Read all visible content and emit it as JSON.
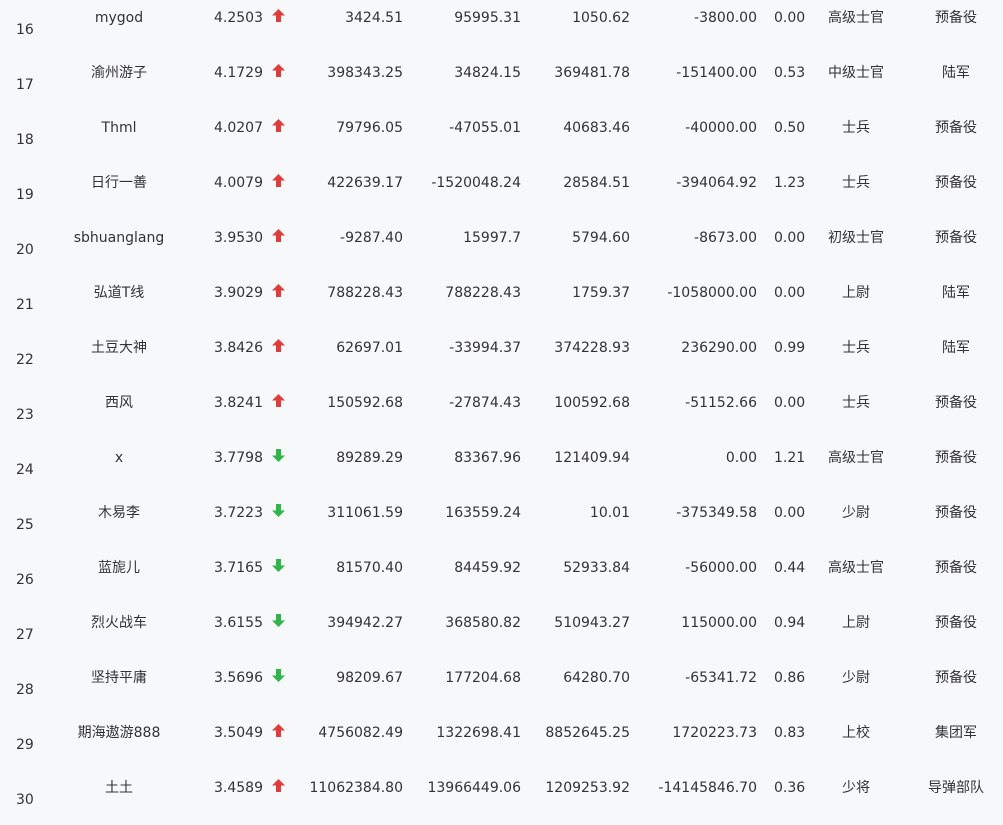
{
  "colors": {
    "up": "#e03c3c",
    "down": "#2fb54a",
    "text": "#333333",
    "background": "#f7f8fa"
  },
  "icons": {
    "up": "arrow-up-icon",
    "down": "arrow-down-icon"
  },
  "rows": [
    {
      "rank": "16",
      "name": "mygod",
      "score": "4.2503",
      "trend": "up",
      "v1": "3424.51",
      "v2": "95995.31",
      "v3": "1050.62",
      "v4": "-3800.00",
      "ratio": "0.00",
      "rank_title": "高级士官",
      "branch": "预备役"
    },
    {
      "rank": "17",
      "name": "渝州游子",
      "score": "4.1729",
      "trend": "up",
      "v1": "398343.25",
      "v2": "34824.15",
      "v3": "369481.78",
      "v4": "-151400.00",
      "ratio": "0.53",
      "rank_title": "中级士官",
      "branch": "陆军"
    },
    {
      "rank": "18",
      "name": "Thml",
      "score": "4.0207",
      "trend": "up",
      "v1": "79796.05",
      "v2": "-47055.01",
      "v3": "40683.46",
      "v4": "-40000.00",
      "ratio": "0.50",
      "rank_title": "士兵",
      "branch": "预备役"
    },
    {
      "rank": "19",
      "name": "日行一善",
      "score": "4.0079",
      "trend": "up",
      "v1": "422639.17",
      "v2": "-1520048.24",
      "v3": "28584.51",
      "v4": "-394064.92",
      "ratio": "1.23",
      "rank_title": "士兵",
      "branch": "预备役"
    },
    {
      "rank": "20",
      "name": "sbhuanglang",
      "score": "3.9530",
      "trend": "up",
      "v1": "-9287.40",
      "v2": "15997.7",
      "v3": "5794.60",
      "v4": "-8673.00",
      "ratio": "0.00",
      "rank_title": "初级士官",
      "branch": "预备役"
    },
    {
      "rank": "21",
      "name": "弘道T线",
      "score": "3.9029",
      "trend": "up",
      "v1": "788228.43",
      "v2": "788228.43",
      "v3": "1759.37",
      "v4": "-1058000.00",
      "ratio": "0.00",
      "rank_title": "上尉",
      "branch": "陆军"
    },
    {
      "rank": "22",
      "name": "土豆大神",
      "score": "3.8426",
      "trend": "up",
      "v1": "62697.01",
      "v2": "-33994.37",
      "v3": "374228.93",
      "v4": "236290.00",
      "ratio": "0.99",
      "rank_title": "士兵",
      "branch": "陆军"
    },
    {
      "rank": "23",
      "name": "西风",
      "score": "3.8241",
      "trend": "up",
      "v1": "150592.68",
      "v2": "-27874.43",
      "v3": "100592.68",
      "v4": "-51152.66",
      "ratio": "0.00",
      "rank_title": "士兵",
      "branch": "预备役"
    },
    {
      "rank": "24",
      "name": "x",
      "score": "3.7798",
      "trend": "down",
      "v1": "89289.29",
      "v2": "83367.96",
      "v3": "121409.94",
      "v4": "0.00",
      "ratio": "1.21",
      "rank_title": "高级士官",
      "branch": "预备役"
    },
    {
      "rank": "25",
      "name": "木易李",
      "score": "3.7223",
      "trend": "down",
      "v1": "311061.59",
      "v2": "163559.24",
      "v3": "10.01",
      "v4": "-375349.58",
      "ratio": "0.00",
      "rank_title": "少尉",
      "branch": "预备役"
    },
    {
      "rank": "26",
      "name": "蓝旎儿",
      "score": "3.7165",
      "trend": "down",
      "v1": "81570.40",
      "v2": "84459.92",
      "v3": "52933.84",
      "v4": "-56000.00",
      "ratio": "0.44",
      "rank_title": "高级士官",
      "branch": "预备役"
    },
    {
      "rank": "27",
      "name": "烈火战车",
      "score": "3.6155",
      "trend": "down",
      "v1": "394942.27",
      "v2": "368580.82",
      "v3": "510943.27",
      "v4": "115000.00",
      "ratio": "0.94",
      "rank_title": "上尉",
      "branch": "预备役"
    },
    {
      "rank": "28",
      "name": "坚持平庸",
      "score": "3.5696",
      "trend": "down",
      "v1": "98209.67",
      "v2": "177204.68",
      "v3": "64280.70",
      "v4": "-65341.72",
      "ratio": "0.86",
      "rank_title": "少尉",
      "branch": "预备役"
    },
    {
      "rank": "29",
      "name": "期海遨游888",
      "score": "3.5049",
      "trend": "up",
      "v1": "4756082.49",
      "v2": "1322698.41",
      "v3": "8852645.25",
      "v4": "1720223.73",
      "ratio": "0.83",
      "rank_title": "上校",
      "branch": "集团军"
    },
    {
      "rank": "30",
      "name": "土土",
      "score": "3.4589",
      "trend": "up",
      "v1": "11062384.80",
      "v2": "13966449.06",
      "v3": "1209253.92",
      "v4": "-14145846.70",
      "ratio": "0.36",
      "rank_title": "少将",
      "branch": "导弹部队"
    }
  ]
}
